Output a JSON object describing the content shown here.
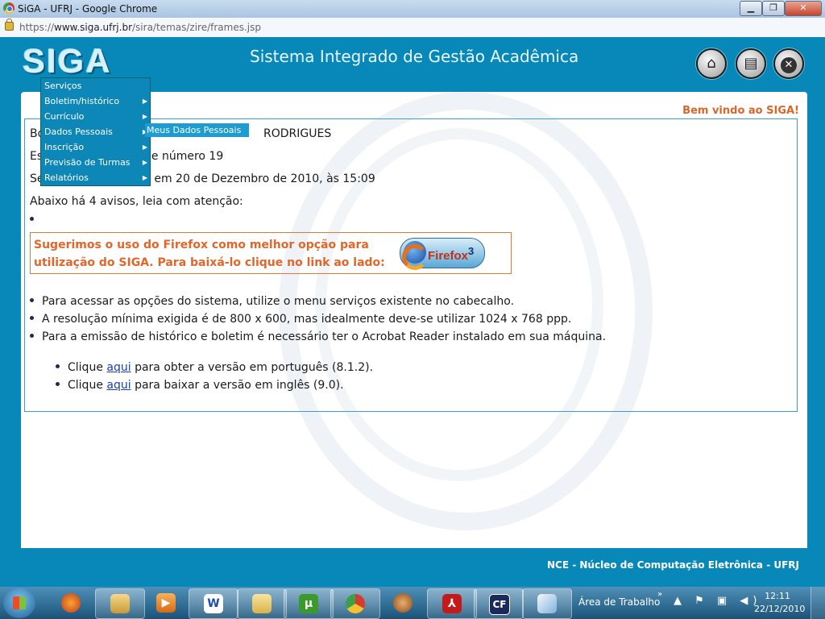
{
  "window": {
    "title": "SiGA - UFRJ - Google Chrome",
    "min": "▁",
    "max": "❐",
    "close": "✕"
  },
  "address": {
    "scheme": "https://",
    "host": "www.siga.ufrj.br",
    "path": "/sira/temas/zire/frames.jsp"
  },
  "header": {
    "logo": "SIGA",
    "title": "Sistema Integrado de Gestão Acadêmica"
  },
  "welcome": "Bem vindo ao SIGA!",
  "menu": {
    "items": [
      {
        "label": "Serviços",
        "arrow": ""
      },
      {
        "label": "Boletim/histórico",
        "arrow": "▶"
      },
      {
        "label": "Currículo",
        "arrow": "▶"
      },
      {
        "label": "Dados Pessoais",
        "arrow": "▶"
      },
      {
        "label": "Inscrição",
        "arrow": "▶"
      },
      {
        "label": "Previsão de Turmas",
        "arrow": "▶"
      },
      {
        "label": "Relatórios",
        "arrow": "▶"
      }
    ],
    "submenu": "Meus Dados Pessoais"
  },
  "content": {
    "line1_start": "Bo",
    "line1_end": "RODRIGUES",
    "line2_start": "Es",
    "line2_end": "de número 19",
    "line3_start": "Se",
    "line3_end": "i em 20 de Dezembro de 2010, às 15:09",
    "notice_intro": "Abaixo há 4 avisos, leia com atenção:",
    "firefox_text": "Sugerimos o uso do Firefox como melhor opção para utilização do SIGA. Para baixá-lo clique no link ao lado:",
    "firefox_btn": "Firefox",
    "firefox_ver": "3",
    "bullets": [
      "Para acessar as opções do sistema, utilize o menu serviços existente no cabecalho.",
      "A resolução mínima exigida é de 800 x 600, mas idealmente deve-se utilizar 1024 x 768 ppp.",
      "Para a emissão de histórico e boletim é necessário ter o Acrobat Reader instalado em sua máquina."
    ],
    "sub1": {
      "pre": "Clique ",
      "link": "aqui",
      "post": " para obter a versão em português (8.1.2)."
    },
    "sub2": {
      "pre": "Clique ",
      "link": "aqui",
      "post": " para baixar a versão em inglês (9.0)."
    }
  },
  "footer": "NCE - Núcleo de Computação Eletrônica - UFRJ",
  "taskbar": {
    "apps": [
      "firefox-icon",
      "explorer-icon",
      "media-player-icon",
      "word-icon",
      "folder-icon",
      "utorrent-icon",
      "chrome-icon",
      "baseball-icon",
      "acrobat-icon",
      "cf-icon",
      "paint-icon"
    ],
    "utorrent": "µ",
    "cf": "CF",
    "word": "W",
    "desktop_label": "Área de Trabalho",
    "chevron": "»",
    "tray": "▲ ⚑ ▣ ◀)",
    "time": "12:11",
    "date": "22/12/2010"
  }
}
